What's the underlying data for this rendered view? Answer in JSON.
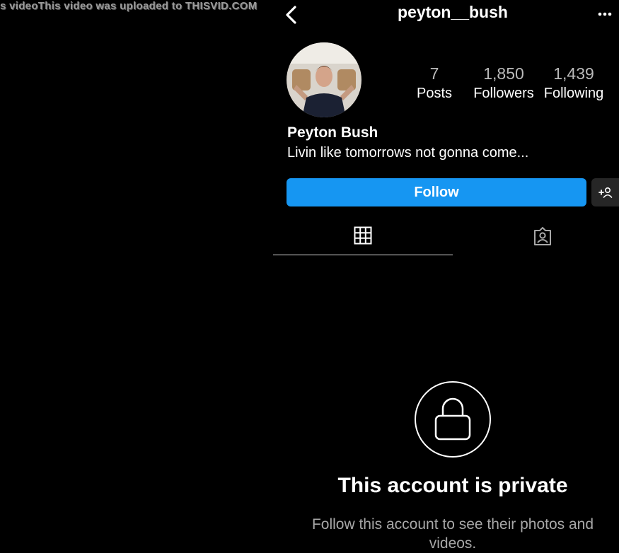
{
  "watermark": "s videoThis video was uploaded to THISVID.COM",
  "header": {
    "username": "peyton__bush",
    "back_icon": "chevron-left-icon",
    "more_icon": "more-horizontal-icon"
  },
  "profile": {
    "avatar_icon": "avatar",
    "stats": [
      {
        "value": "7",
        "label": "Posts"
      },
      {
        "value": "1,850",
        "label": "Followers"
      },
      {
        "value": "1,439",
        "label": "Following"
      }
    ],
    "display_name": "Peyton Bush",
    "bio": "Livin like tomorrows not gonna come..."
  },
  "actions": {
    "follow_label": "Follow",
    "suggest_icon": "add-person-icon"
  },
  "tabs": [
    {
      "icon": "grid-icon",
      "active": true
    },
    {
      "icon": "tagged-icon",
      "active": false
    }
  ],
  "private": {
    "icon": "lock-icon",
    "title": "This account is private",
    "description": "Follow this account to see their photos and videos."
  },
  "colors": {
    "background": "#000000",
    "follow_button": "#1696f2",
    "secondary_text": "#a8a8a8"
  }
}
